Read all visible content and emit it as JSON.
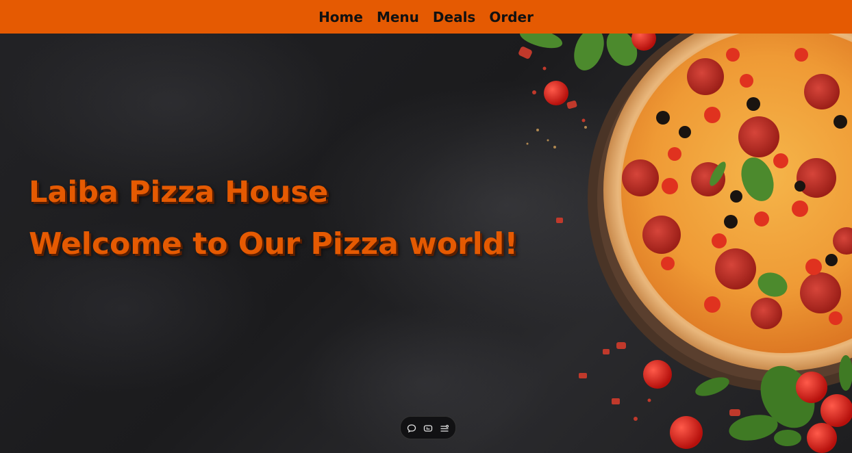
{
  "nav": {
    "items": [
      {
        "label": "Home"
      },
      {
        "label": "Menu"
      },
      {
        "label": "Deals"
      },
      {
        "label": "Order"
      }
    ]
  },
  "hero": {
    "title": "Laiba Pizza House",
    "subtitle": "Welcome to Our Pizza world!"
  },
  "controls": {
    "icons": [
      "chat-bubble-icon",
      "caption-icon",
      "settings-list-icon"
    ]
  },
  "colors": {
    "accent": "#e55a02",
    "background": "#1c1c1e",
    "nav_text": "#111111"
  }
}
